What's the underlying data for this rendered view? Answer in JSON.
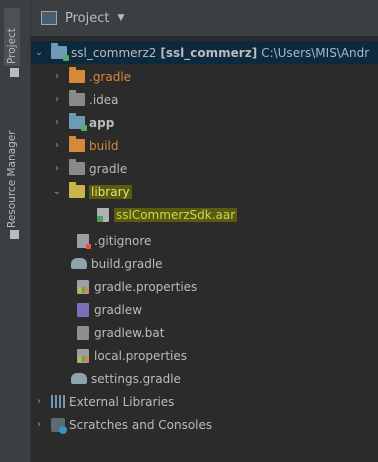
{
  "sidebar": {
    "project_tab": "Project",
    "resource_tab": "Resource Manager"
  },
  "header": {
    "title": "Project"
  },
  "tree": {
    "root": {
      "name": "ssl_commerz2",
      "module": "[ssl_commerz]",
      "path": "C:\\Users\\MIS\\Andr"
    },
    "items": [
      {
        "label": ".gradle"
      },
      {
        "label": ".idea"
      },
      {
        "label": "app"
      },
      {
        "label": "build"
      },
      {
        "label": "gradle"
      },
      {
        "label": "library"
      },
      {
        "label": "sslCommerzSdk.aar"
      },
      {
        "label": ".gitignore"
      },
      {
        "label": "build.gradle"
      },
      {
        "label": "gradle.properties"
      },
      {
        "label": "gradlew"
      },
      {
        "label": "gradlew.bat"
      },
      {
        "label": "local.properties"
      },
      {
        "label": "settings.gradle"
      },
      {
        "label": "External Libraries"
      },
      {
        "label": "Scratches and Consoles"
      }
    ]
  },
  "colors": {
    "background": "#2b2b2b",
    "panel": "#3c3f41",
    "selection": "#0d293e",
    "highlight": "#5a5a12",
    "excluded_folder": "#d7893a"
  }
}
